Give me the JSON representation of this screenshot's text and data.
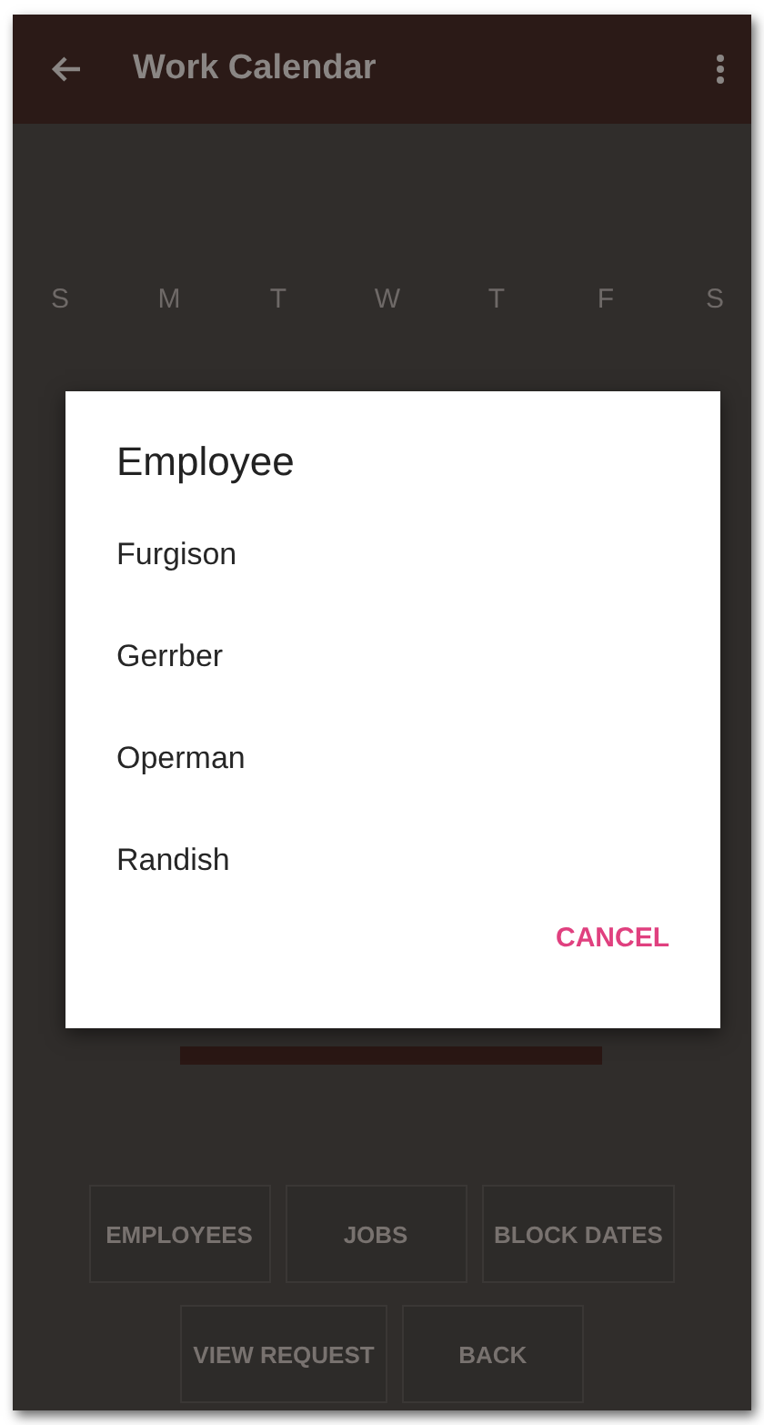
{
  "app_bar": {
    "title": "Work Calendar"
  },
  "calendar": {
    "weekdays": [
      "S",
      "M",
      "T",
      "W",
      "T",
      "F",
      "S"
    ]
  },
  "buttons": [
    [
      "EMPLOYEES",
      "JOBS",
      "BLOCK DATES"
    ],
    [
      "VIEW REQUEST",
      "BACK"
    ]
  ],
  "dialog": {
    "title": "Employee",
    "items": [
      "Furgison",
      "Gerrber",
      "Operman",
      "Randish"
    ],
    "cancel": "CANCEL"
  }
}
